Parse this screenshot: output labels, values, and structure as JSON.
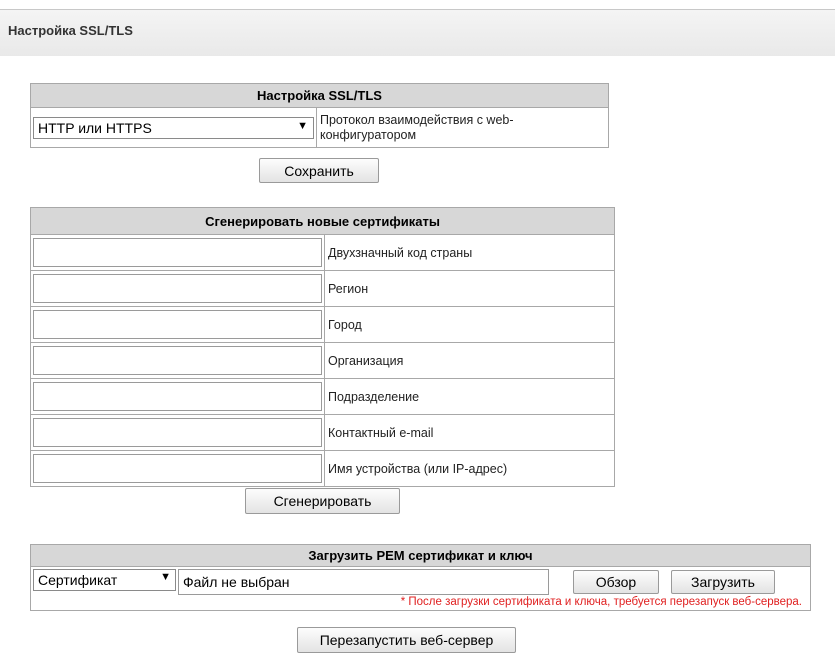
{
  "page": {
    "title": "Настройка SSL/TLS"
  },
  "ssl_section": {
    "header": "Настройка SSL/TLS",
    "protocol_value": "HTTP или HTTPS",
    "protocol_label": "Протокол взаимодействия с web-конфигуратором",
    "save_label": "Сохранить"
  },
  "generate_section": {
    "header": "Сгенерировать новые сертификаты",
    "fields": [
      {
        "label": "Двухзначный код страны",
        "value": ""
      },
      {
        "label": "Регион",
        "value": ""
      },
      {
        "label": "Город",
        "value": ""
      },
      {
        "label": "Организация",
        "value": ""
      },
      {
        "label": "Подразделение",
        "value": ""
      },
      {
        "label": "Контактный e-mail",
        "value": ""
      },
      {
        "label": "Имя устройства (или IP-адрес)",
        "value": ""
      }
    ],
    "generate_label": "Сгенерировать"
  },
  "upload_section": {
    "header": "Загрузить PEM сертификат и ключ",
    "type_value": "Сертификат",
    "file_status": "Файл не выбран",
    "browse_label": "Обзор",
    "upload_label": "Загрузить",
    "warning": "* После загрузки сертификата и ключа, требуется перезапуск веб-сервера."
  },
  "restart_label": "Перезапустить веб-сервер",
  "colors": {
    "section_header_bg": "#d7d7d7",
    "warning_text": "#e02020",
    "border": "#a8a8a8"
  }
}
